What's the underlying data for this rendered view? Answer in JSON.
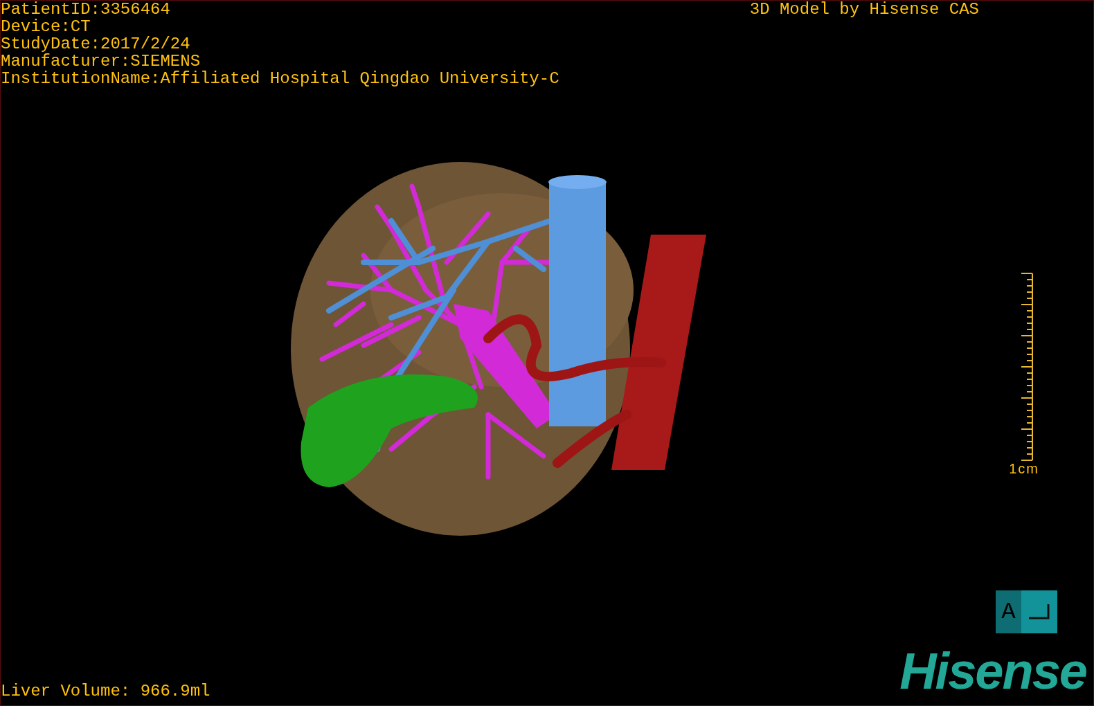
{
  "patient_info": [
    "PatientID:3356464",
    "Device:CT",
    "StudyDate:2017/2/24",
    "Manufacturer:SIEMENS",
    "InstitutionName:Affiliated Hospital Qingdao University-C"
  ],
  "model_credit": "3D Model by Hisense CAS",
  "scale_bar": {
    "label": "1cm"
  },
  "liver_volume": "Liver Volume: 966.9ml",
  "orientation_cube": {
    "label": "A"
  },
  "logo": "Hisense"
}
